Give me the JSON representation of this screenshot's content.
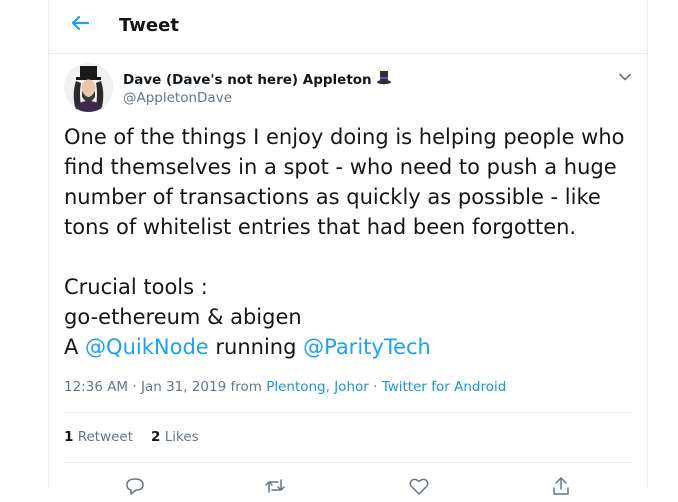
{
  "header": {
    "title": "Tweet",
    "back_icon": "arrow-left-icon",
    "accent": "#1da1f2"
  },
  "author": {
    "name": "Dave (Dave's not here) Appleton",
    "name_emoji": "top-hat-icon",
    "handle": "@AppletonDave",
    "avatar": "avatar"
  },
  "tweet": {
    "line1": "One of the things I enjoy doing is helping people who",
    "line2": "find themselves in a spot - who need to push a huge",
    "line3": "number of transactions as quickly as possible - like",
    "line4": "tons of whitelist entries that had been forgotten.",
    "line5": "Crucial tools :",
    "line6": "go-ethereum & abigen",
    "line7_prefix": "A ",
    "mention1": "@QuikNode",
    "line7_middle": " running ",
    "mention2": "@ParityTech"
  },
  "meta": {
    "time": "12:36 AM",
    "sep1": " · ",
    "date": "Jan 31, 2019",
    "from_word": " from ",
    "location": "Plentong, Johor",
    "sep2": " · ",
    "source": "Twitter for Android"
  },
  "stats": {
    "retweets_count": "1",
    "retweets_label": "Retweet",
    "likes_count": "2",
    "likes_label": "Likes"
  },
  "actions": [
    "reply-icon",
    "retweet-icon",
    "like-icon",
    "share-icon"
  ],
  "colors": {
    "text": "#14171a",
    "secondary": "#657786",
    "link": "#1b95e0",
    "border": "#e6ecf0"
  }
}
